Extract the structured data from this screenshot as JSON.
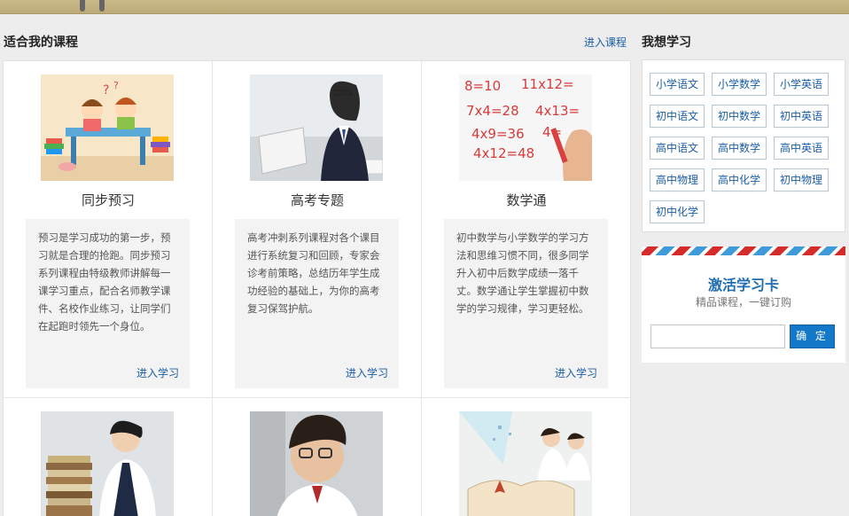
{
  "main": {
    "title": "适合我的课程",
    "more_link": "进入课程",
    "courses": [
      {
        "name": "同步预习",
        "description": "预习是学习成功的第一步，预习就是合理的抢跑。同步预习系列课程由特级教师讲解每一课学习重点，配合名师教学课件、名校作业练习，让同学们在起跑时领先一个身位。",
        "enter_label": "进入学习",
        "image": "cartoon-kids-studying-illustration"
      },
      {
        "name": "高考专题",
        "description": "高考冲刺系列课程对各个课目进行系统复习和回顾，专家会诊考前策略，总结历年学生成功经验的基础上，为你的高考复习保驾护航。",
        "enter_label": "进入学习",
        "image": "student-with-laptop-photo"
      },
      {
        "name": "数学通",
        "description": "初中数学与小学数学的学习方法和思维习惯不同，很多同学升入初中后数学成绩一落千丈。数学通让学生掌握初中数学的学习规律，学习更轻松。",
        "enter_label": "进入学习",
        "image": "hand-writing-math-on-whiteboard-photo"
      },
      {
        "image": "student-thinking-with-books-photo"
      },
      {
        "image": "student-with-glasses-photo"
      },
      {
        "image": "girls-reading-book-photo"
      }
    ]
  },
  "sidebar": {
    "title": "我想学习",
    "tags": [
      "小学语文",
      "小学数学",
      "小学英语",
      "初中语文",
      "初中数学",
      "初中英语",
      "高中语文",
      "高中数学",
      "高中英语",
      "高中物理",
      "高中化学",
      "初中物理",
      "初中化学"
    ],
    "activate_card": {
      "title": "激活学习卡",
      "subtitle": "精品课程，一键订购",
      "input_value": "",
      "button_label": "确 定"
    }
  },
  "colors": {
    "link": "#1a5ea8",
    "button": "#1478c8",
    "airmail_red": "#d52b2b",
    "airmail_blue": "#3e9ad8"
  }
}
